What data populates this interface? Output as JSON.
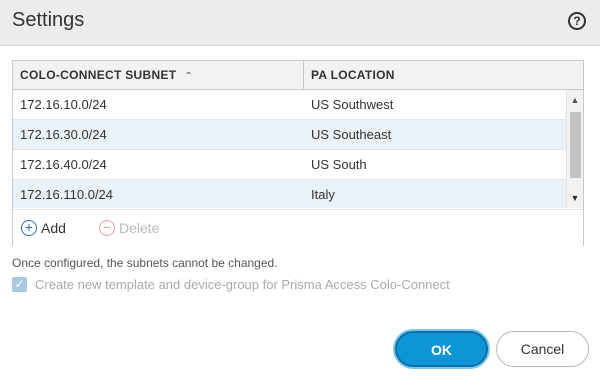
{
  "dialog": {
    "title": "Settings",
    "help_icon": "?"
  },
  "table": {
    "columns": [
      "COLO-CONNECT SUBNET",
      "PA LOCATION"
    ],
    "sort_indicator": "^",
    "rows": [
      {
        "subnet": "172.16.10.0/24",
        "location": "US Southwest"
      },
      {
        "subnet": "172.16.30.0/24",
        "location": "US Southeast"
      },
      {
        "subnet": "172.16.40.0/24",
        "location": "US South"
      },
      {
        "subnet": "172.16.110.0/24",
        "location": "Italy"
      }
    ],
    "add_label": "Add",
    "delete_label": "Delete"
  },
  "note": "Once configured, the subnets cannot be changed.",
  "checkbox": {
    "label": "Create new template and device-group for Prisma Access Colo-Connect",
    "checked": true
  },
  "buttons": {
    "ok": "OK",
    "cancel": "Cancel"
  },
  "colors": {
    "accent": "#0d95d6",
    "row_alt": "#eaf2f8",
    "header_bg": "#ececec"
  }
}
